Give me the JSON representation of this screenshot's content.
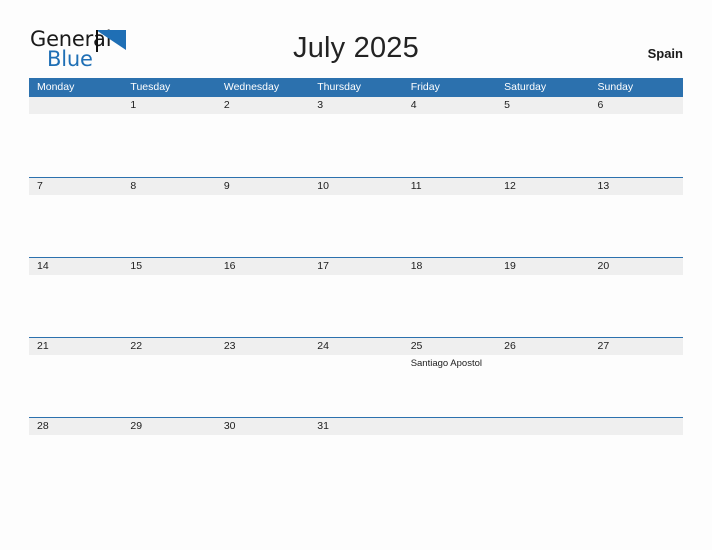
{
  "brand": {
    "name_part1": "General",
    "name_part2": "Blue",
    "mark": "triangle-flag-mark",
    "accent_color": "#1f6fb5"
  },
  "header": {
    "title": "July 2025",
    "country": "Spain"
  },
  "colors": {
    "header_blue": "#2c71ae",
    "row_band_gray": "#efefef",
    "page_background": "#fdfdfd",
    "text": "#1d1d1d"
  },
  "calendar": {
    "month": "July",
    "year": "2025",
    "day_headers": [
      "Monday",
      "Tuesday",
      "Wednesday",
      "Thursday",
      "Friday",
      "Saturday",
      "Sunday"
    ],
    "weeks": [
      {
        "days": [
          {
            "num": "",
            "event": ""
          },
          {
            "num": "1",
            "event": ""
          },
          {
            "num": "2",
            "event": ""
          },
          {
            "num": "3",
            "event": ""
          },
          {
            "num": "4",
            "event": ""
          },
          {
            "num": "5",
            "event": ""
          },
          {
            "num": "6",
            "event": ""
          }
        ]
      },
      {
        "days": [
          {
            "num": "7",
            "event": ""
          },
          {
            "num": "8",
            "event": ""
          },
          {
            "num": "9",
            "event": ""
          },
          {
            "num": "10",
            "event": ""
          },
          {
            "num": "11",
            "event": ""
          },
          {
            "num": "12",
            "event": ""
          },
          {
            "num": "13",
            "event": ""
          }
        ]
      },
      {
        "days": [
          {
            "num": "14",
            "event": ""
          },
          {
            "num": "15",
            "event": ""
          },
          {
            "num": "16",
            "event": ""
          },
          {
            "num": "17",
            "event": ""
          },
          {
            "num": "18",
            "event": ""
          },
          {
            "num": "19",
            "event": ""
          },
          {
            "num": "20",
            "event": ""
          }
        ]
      },
      {
        "days": [
          {
            "num": "21",
            "event": ""
          },
          {
            "num": "22",
            "event": ""
          },
          {
            "num": "23",
            "event": ""
          },
          {
            "num": "24",
            "event": ""
          },
          {
            "num": "25",
            "event": "Santiago Apostol"
          },
          {
            "num": "26",
            "event": ""
          },
          {
            "num": "27",
            "event": ""
          }
        ]
      },
      {
        "days": [
          {
            "num": "28",
            "event": ""
          },
          {
            "num": "29",
            "event": ""
          },
          {
            "num": "30",
            "event": ""
          },
          {
            "num": "31",
            "event": ""
          },
          {
            "num": "",
            "event": ""
          },
          {
            "num": "",
            "event": ""
          },
          {
            "num": "",
            "event": ""
          }
        ]
      }
    ]
  }
}
